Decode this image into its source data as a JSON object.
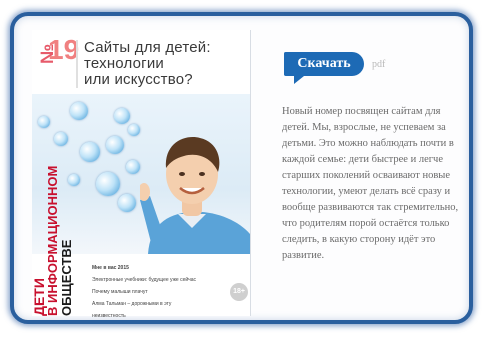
{
  "cover": {
    "issue_prefix": "№",
    "issue_number": "19",
    "title_line1": "Сайты для детей:",
    "title_line2": "технологии",
    "title_line3": "или искусство?",
    "vertical_title": [
      "ДЕТИ",
      "В ИНФОРМАЦИОННОМ",
      "ОБЩЕСТВЕ"
    ],
    "toc": [
      "Мне в вас 2015",
      "Электронные учебники: будущее уже сейчас",
      "Почему малыши плачут",
      "Алма Тальман – дорожными в эту неизвестность"
    ],
    "age_badge": "18+"
  },
  "download": {
    "label": "Скачать",
    "format": "pdf"
  },
  "description": "Новый номер посвящен сайтам для детей. Мы, взрослые, не успеваем за детьми. Это можно наблюдать почти в каждой семье: дети быстрее и легче старших поколений осваивают новые технологии, умеют делать всё сразу и вообще развиваются так стремительно, что родителям порой остаётся только следить, в какую сторону идёт это развитие.",
  "colors": {
    "accent": "#1d6ab5",
    "frame": "#2a5f9e",
    "cover_red": "#c8102e"
  }
}
